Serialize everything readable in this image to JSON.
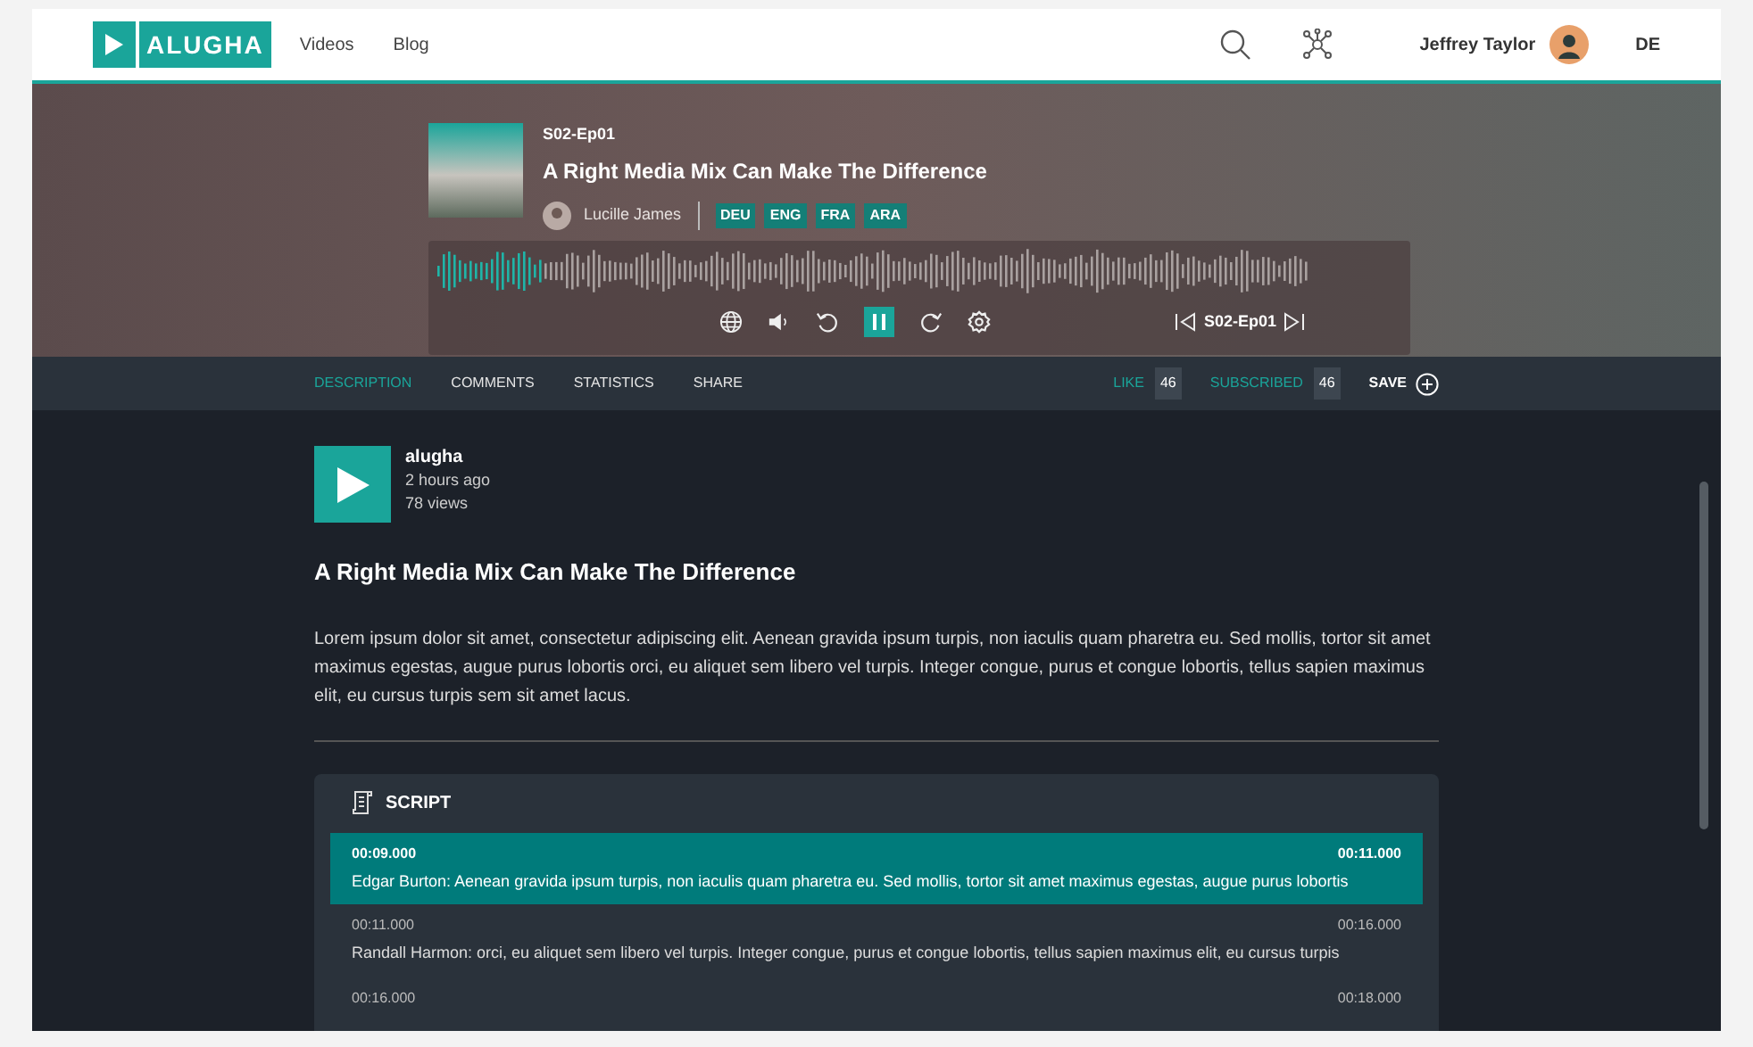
{
  "header": {
    "logo": "ALUGHA",
    "nav": [
      {
        "label": "Videos"
      },
      {
        "label": "Blog"
      }
    ],
    "user": "Jeffrey Taylor",
    "language": "DE"
  },
  "player": {
    "episode": "S02-Ep01",
    "title": "A Right Media Mix Can Make The Difference",
    "author": "Lucille James",
    "languages": [
      "DEU",
      "ENG",
      "FRA",
      "ARA"
    ],
    "progress": {
      "level": 0.12
    },
    "playing": true,
    "current_episode": "S02-Ep01"
  },
  "tabs": [
    {
      "label": "DESCRIPTION",
      "selected": true
    },
    {
      "label": "COMMENTS",
      "selected": false
    },
    {
      "label": "STATISTICS",
      "selected": false
    },
    {
      "label": "SHARE",
      "selected": false
    }
  ],
  "actions": {
    "like": "LIKE",
    "like_count": "46",
    "subscribed": "SUBSCRIBED",
    "subscribed_count": "46",
    "save": "SAVE"
  },
  "channel": {
    "name": "alugha",
    "time": "2 hours ago",
    "views": "78 views"
  },
  "video_title": "A Right Media Mix Can Make The Difference",
  "description": "Lorem ipsum dolor sit amet, consectetur adipiscing elit. Aenean gravida ipsum turpis, non iaculis quam pharetra eu. Sed mollis, tortor sit amet maximus egestas, augue purus lobortis orci, eu aliquet sem libero vel turpis. Integer congue, purus et congue lobortis, tellus sapien maximus elit, eu cursus turpis sem sit amet lacus.",
  "script": {
    "title": "SCRIPT",
    "rows": [
      {
        "start": "00:09.000",
        "end": "00:11.000",
        "text": "Edgar Burton: Aenean gravida ipsum turpis, non iaculis quam pharetra eu. Sed mollis, tortor sit amet maximus egestas, augue purus lobortis",
        "selected": true
      },
      {
        "start": "00:11.000",
        "end": "00:16.000",
        "text": "Randall Harmon: orci, eu aliquet sem libero vel turpis. Integer congue, purus et congue lobortis, tellus sapien maximus elit, eu cursus turpis",
        "selected": false
      },
      {
        "start": "00:16.000",
        "end": "00:18.000",
        "selected": false
      }
    ]
  }
}
